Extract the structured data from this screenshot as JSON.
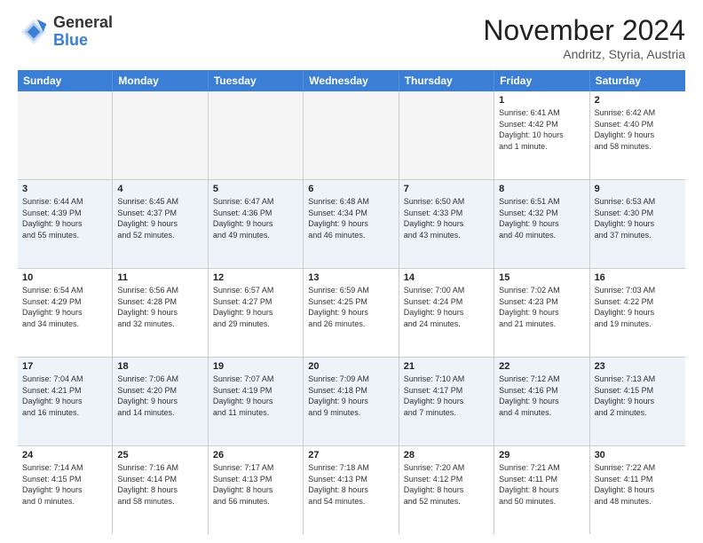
{
  "logo": {
    "general": "General",
    "blue": "Blue"
  },
  "header": {
    "month": "November 2024",
    "location": "Andritz, Styria, Austria"
  },
  "weekdays": [
    "Sunday",
    "Monday",
    "Tuesday",
    "Wednesday",
    "Thursday",
    "Friday",
    "Saturday"
  ],
  "rows": [
    [
      {
        "day": "",
        "text": "",
        "empty": true
      },
      {
        "day": "",
        "text": "",
        "empty": true
      },
      {
        "day": "",
        "text": "",
        "empty": true
      },
      {
        "day": "",
        "text": "",
        "empty": true
      },
      {
        "day": "",
        "text": "",
        "empty": true
      },
      {
        "day": "1",
        "text": "Sunrise: 6:41 AM\nSunset: 4:42 PM\nDaylight: 10 hours\nand 1 minute.",
        "empty": false
      },
      {
        "day": "2",
        "text": "Sunrise: 6:42 AM\nSunset: 4:40 PM\nDaylight: 9 hours\nand 58 minutes.",
        "empty": false
      }
    ],
    [
      {
        "day": "3",
        "text": "Sunrise: 6:44 AM\nSunset: 4:39 PM\nDaylight: 9 hours\nand 55 minutes.",
        "empty": false
      },
      {
        "day": "4",
        "text": "Sunrise: 6:45 AM\nSunset: 4:37 PM\nDaylight: 9 hours\nand 52 minutes.",
        "empty": false
      },
      {
        "day": "5",
        "text": "Sunrise: 6:47 AM\nSunset: 4:36 PM\nDaylight: 9 hours\nand 49 minutes.",
        "empty": false
      },
      {
        "day": "6",
        "text": "Sunrise: 6:48 AM\nSunset: 4:34 PM\nDaylight: 9 hours\nand 46 minutes.",
        "empty": false
      },
      {
        "day": "7",
        "text": "Sunrise: 6:50 AM\nSunset: 4:33 PM\nDaylight: 9 hours\nand 43 minutes.",
        "empty": false
      },
      {
        "day": "8",
        "text": "Sunrise: 6:51 AM\nSunset: 4:32 PM\nDaylight: 9 hours\nand 40 minutes.",
        "empty": false
      },
      {
        "day": "9",
        "text": "Sunrise: 6:53 AM\nSunset: 4:30 PM\nDaylight: 9 hours\nand 37 minutes.",
        "empty": false
      }
    ],
    [
      {
        "day": "10",
        "text": "Sunrise: 6:54 AM\nSunset: 4:29 PM\nDaylight: 9 hours\nand 34 minutes.",
        "empty": false
      },
      {
        "day": "11",
        "text": "Sunrise: 6:56 AM\nSunset: 4:28 PM\nDaylight: 9 hours\nand 32 minutes.",
        "empty": false
      },
      {
        "day": "12",
        "text": "Sunrise: 6:57 AM\nSunset: 4:27 PM\nDaylight: 9 hours\nand 29 minutes.",
        "empty": false
      },
      {
        "day": "13",
        "text": "Sunrise: 6:59 AM\nSunset: 4:25 PM\nDaylight: 9 hours\nand 26 minutes.",
        "empty": false
      },
      {
        "day": "14",
        "text": "Sunrise: 7:00 AM\nSunset: 4:24 PM\nDaylight: 9 hours\nand 24 minutes.",
        "empty": false
      },
      {
        "day": "15",
        "text": "Sunrise: 7:02 AM\nSunset: 4:23 PM\nDaylight: 9 hours\nand 21 minutes.",
        "empty": false
      },
      {
        "day": "16",
        "text": "Sunrise: 7:03 AM\nSunset: 4:22 PM\nDaylight: 9 hours\nand 19 minutes.",
        "empty": false
      }
    ],
    [
      {
        "day": "17",
        "text": "Sunrise: 7:04 AM\nSunset: 4:21 PM\nDaylight: 9 hours\nand 16 minutes.",
        "empty": false
      },
      {
        "day": "18",
        "text": "Sunrise: 7:06 AM\nSunset: 4:20 PM\nDaylight: 9 hours\nand 14 minutes.",
        "empty": false
      },
      {
        "day": "19",
        "text": "Sunrise: 7:07 AM\nSunset: 4:19 PM\nDaylight: 9 hours\nand 11 minutes.",
        "empty": false
      },
      {
        "day": "20",
        "text": "Sunrise: 7:09 AM\nSunset: 4:18 PM\nDaylight: 9 hours\nand 9 minutes.",
        "empty": false
      },
      {
        "day": "21",
        "text": "Sunrise: 7:10 AM\nSunset: 4:17 PM\nDaylight: 9 hours\nand 7 minutes.",
        "empty": false
      },
      {
        "day": "22",
        "text": "Sunrise: 7:12 AM\nSunset: 4:16 PM\nDaylight: 9 hours\nand 4 minutes.",
        "empty": false
      },
      {
        "day": "23",
        "text": "Sunrise: 7:13 AM\nSunset: 4:15 PM\nDaylight: 9 hours\nand 2 minutes.",
        "empty": false
      }
    ],
    [
      {
        "day": "24",
        "text": "Sunrise: 7:14 AM\nSunset: 4:15 PM\nDaylight: 9 hours\nand 0 minutes.",
        "empty": false
      },
      {
        "day": "25",
        "text": "Sunrise: 7:16 AM\nSunset: 4:14 PM\nDaylight: 8 hours\nand 58 minutes.",
        "empty": false
      },
      {
        "day": "26",
        "text": "Sunrise: 7:17 AM\nSunset: 4:13 PM\nDaylight: 8 hours\nand 56 minutes.",
        "empty": false
      },
      {
        "day": "27",
        "text": "Sunrise: 7:18 AM\nSunset: 4:13 PM\nDaylight: 8 hours\nand 54 minutes.",
        "empty": false
      },
      {
        "day": "28",
        "text": "Sunrise: 7:20 AM\nSunset: 4:12 PM\nDaylight: 8 hours\nand 52 minutes.",
        "empty": false
      },
      {
        "day": "29",
        "text": "Sunrise: 7:21 AM\nSunset: 4:11 PM\nDaylight: 8 hours\nand 50 minutes.",
        "empty": false
      },
      {
        "day": "30",
        "text": "Sunrise: 7:22 AM\nSunset: 4:11 PM\nDaylight: 8 hours\nand 48 minutes.",
        "empty": false
      }
    ]
  ]
}
